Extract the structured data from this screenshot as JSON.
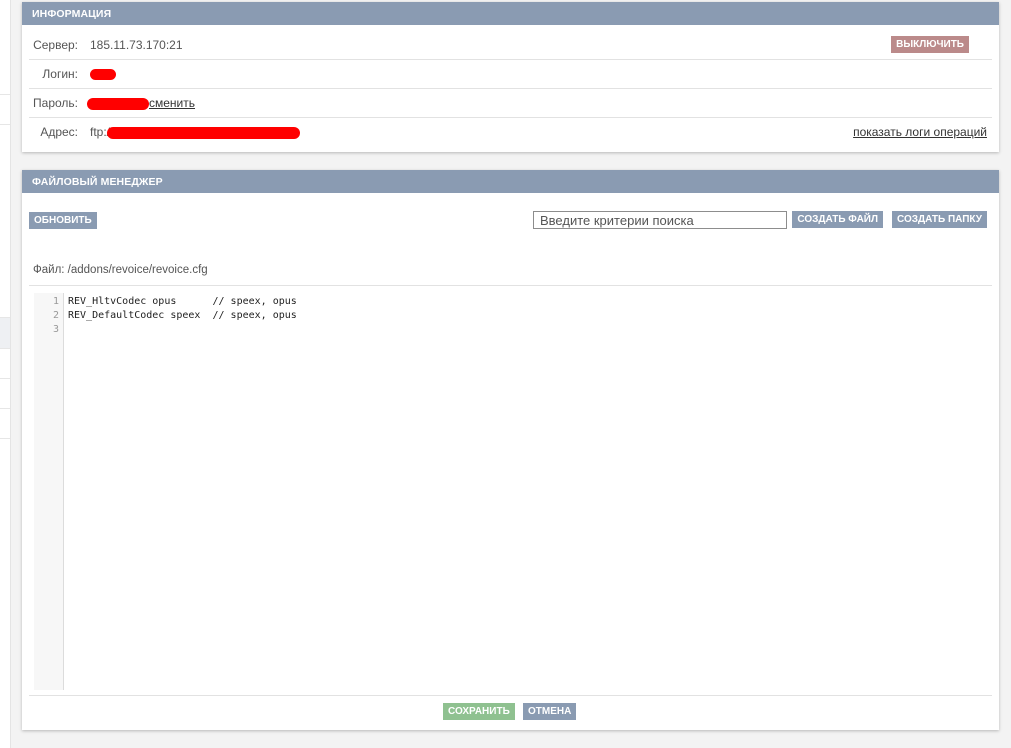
{
  "info": {
    "title": "ИНФОРМАЦИЯ",
    "server_label": "Сервер:",
    "server_value": "185.11.73.170:21",
    "shutdown_label": "ВЫКЛЮЧИТЬ",
    "login_label": "Логин:",
    "password_label": "Пароль:",
    "change_label": "сменить",
    "address_label": "Адрес:",
    "address_prefix": "ftp://",
    "logs_label": "показать логи операций"
  },
  "file_manager": {
    "title": "ФАЙЛОВЫЙ МЕНЕДЖЕР",
    "refresh_label": "ОБНОВИТЬ",
    "search_placeholder": "Введите критерии поиска",
    "create_file_label": "СОЗДАТЬ ФАЙЛ",
    "create_folder_label": "СОЗДАТЬ ПАПКУ",
    "file_path": "Файл: /addons/revoice/revoice.cfg",
    "editor": {
      "line_numbers": [
        "1",
        "2",
        "3"
      ],
      "lines": [
        "REV_HltvCodec opus      // speex, opus",
        "REV_DefaultCodec speex  // speex, opus",
        ""
      ]
    },
    "save_label": "СОХРАНИТЬ",
    "cancel_label": "ОТМЕНА"
  },
  "colors": {
    "header": "#8a9bb2",
    "danger_button": "#bb8a8a",
    "save_button": "#8fc190",
    "redaction": "#ff0000"
  }
}
